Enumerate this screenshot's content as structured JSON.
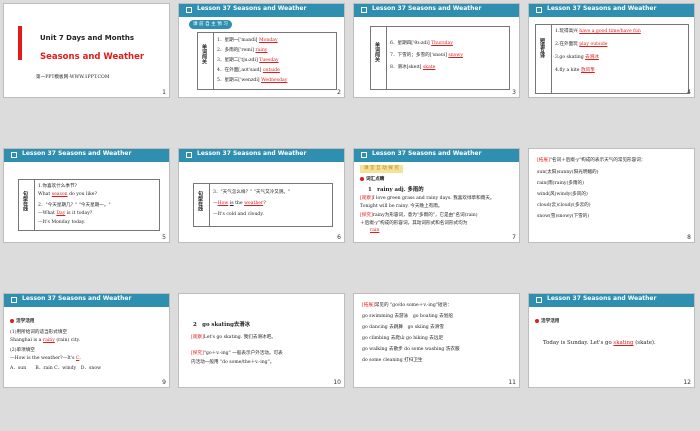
{
  "lesson_header": "Lesson 37    Seasons and Weather",
  "slides": {
    "s1": {
      "number": "1",
      "unit": "Unit 7  Days and Months",
      "title": "Seasons and Weather",
      "footer": "第一PPT模板网-WWW.1PPT.COM"
    },
    "s2": {
      "number": "2",
      "badge": "课 前 自 主 预 习",
      "side_label": "单词闯关",
      "items": [
        {
          "label": "1．星期一['mʌndi]",
          "answer": "Monday"
        },
        {
          "label": "2．多雨的['reɪni]",
          "answer": "rainy"
        },
        {
          "label": "3．星期二['tju:zdi]",
          "answer": "Tuesday"
        },
        {
          "label": "4．在外面[ˌaʊt'saɪd]",
          "answer": "outside"
        },
        {
          "label": "5．星期三['wenzdi]",
          "answer": "Wednesday"
        }
      ]
    },
    "s3": {
      "number": "3",
      "side_label": "单词闯关",
      "items": [
        {
          "label": "6．星期四['θɜ:zdi]",
          "answer": "Thursday"
        },
        {
          "label": "7．下雪的；多雪的['snəʊi]",
          "answer": "snowy"
        },
        {
          "label": "8．滑冰[skeɪt]",
          "answer": "skate"
        }
      ]
    },
    "s4": {
      "number": "4",
      "side_label": "短语互译",
      "items": [
        {
          "label": "1.玩得高兴",
          "answer": "have a good time/have fun"
        },
        {
          "label": "2.在外面玩",
          "answer": "play outside"
        },
        {
          "label": "3.go skating",
          "answer": "去滑冰"
        },
        {
          "label": "4.fly a kite",
          "answer": "放风筝"
        }
      ]
    },
    "s5": {
      "number": "5",
      "side_label": "句型在线",
      "line1": "1.你喜欢什么季节?",
      "line2_pre": "What",
      "line2_ans": "season",
      "line2_post": "do you like?",
      "line3": "2．\"今天星期几？\" \"今天星期一。\"",
      "line4_pre": "—What",
      "line4_ans": "Day",
      "line4_mid": "is",
      "line4_post": "it today?",
      "line5": "—It's Monday today."
    },
    "s6": {
      "number": "6",
      "side_label": "句型在线",
      "line1": "3．\"天气怎么样？\" \"天气又冷又阴。\"",
      "line2_pre": "—",
      "line2_ans1": "How",
      "line2_mid": "is",
      "line2_pre2": "the",
      "line2_ans2": "weather",
      "line2_post": "?",
      "line3": "—It's cold and cloudy."
    },
    "s7": {
      "number": "7",
      "badge": "课 堂 互 动 探 究",
      "section": "词汇点睛",
      "word_num": "1",
      "word": "rainy adj. 多雨的",
      "ex1_tag": "[观察]",
      "ex1": "I love green grass and rainy days. 我喜欢绿草和雨天。",
      "ex2": "Tonight will be rainy. 今天晚上有雨。",
      "ex3_tag": "[探究]",
      "ex3": "rainy为形容词，意为\"多雨的\"，它是由\"名词(rain)",
      "ex4": "＋后缀-y\"构成的形容词，其动词形式和名词形式均为",
      "ex5_ans": "rain"
    },
    "s8": {
      "number": "8",
      "intro_tag": "[拓展]",
      "intro": "\"名词＋后缀-y\"构成的表示天气的常见形容词：",
      "items": [
        "sun(太阳)sunny(阳光明媚的)",
        "rain(雨)rainy(多雨的)",
        "wind(风)windy(多风的)",
        "cloud(云)cloudy(多云的)",
        "snow(雪)snowy(下雪的)"
      ]
    },
    "s9": {
      "number": "9",
      "section": "活学活用",
      "q1": "(1)用所给词的适当形式填空",
      "q1b_pre": "Shanghai is a",
      "q1b_ans": "rainy",
      "q1b_post": "(rain) city.",
      "q2": "(2)单项填空",
      "q2b_pre": "—How is the weather?—It's",
      "q2b_ans": "C",
      "q2b_post": ".",
      "opts": "A．sun　　B．rain  C．windy　D．snow"
    },
    "s10": {
      "number": "10",
      "word_num": "2",
      "word": "go skating去滑冰",
      "ex1_tag": "[观察]",
      "ex1": "Let's go skating. 我们去滑冰吧。",
      "ex2_tag": "[探究]",
      "ex2": "\"go＋v.-ing\" 一般表示户外活动。可表",
      "ex3": "内活动一般用 \"do some/the＋v.-ing\"。"
    },
    "s11": {
      "number": "11",
      "intro_tag": "[拓展]",
      "intro": "常见的 \"go/do some＋v.-ing\"短语：",
      "rows": [
        "go swimming 去游泳　go boating 去划船",
        "go dancing 去跳舞　go skiing 去滑雪",
        "go climbing 去爬山  go hiking 去远足",
        "go walking 去散步  do some washing 洗衣服",
        "do some cleaning 打扫卫生"
      ]
    },
    "s12": {
      "number": "12",
      "section": "活学活用",
      "pre": "Today is Sunday. Let's go",
      "ans": "skating",
      "post": "(skate)."
    }
  }
}
